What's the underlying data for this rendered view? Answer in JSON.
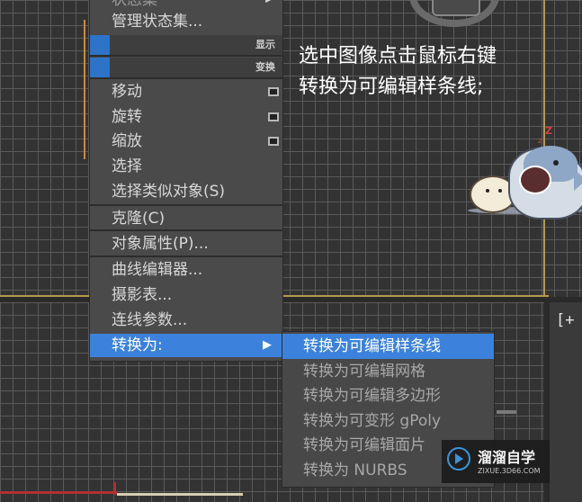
{
  "menu": {
    "partial_top_label": "状态集",
    "manage_label": "管理状态集...",
    "quad_display": "显示",
    "quad_transform": "变换",
    "items": [
      {
        "label": "移动",
        "checkbox": true
      },
      {
        "label": "旋转",
        "checkbox": true
      },
      {
        "label": "缩放",
        "checkbox": true
      },
      {
        "label": "选择",
        "checkbox": false
      },
      {
        "label": "选择类似对象(S)",
        "checkbox": false
      }
    ],
    "clone_label": "克隆(C)",
    "properties_label": "对象属性(P)...",
    "curve_editor_label": "曲线编辑器...",
    "dope_sheet_label": "摄影表...",
    "wire_params_label": "连线参数...",
    "convert_label": "转换为:"
  },
  "submenu": {
    "items": [
      {
        "label": "转换为可编辑样条线",
        "highlighted": true
      },
      {
        "label": "转换为可编辑网格",
        "highlighted": false
      },
      {
        "label": "转换为可编辑多边形",
        "highlighted": false
      },
      {
        "label": "转换为可变形 gPoly",
        "highlighted": false
      },
      {
        "label": "转换为可编辑面片",
        "highlighted": false
      },
      {
        "label": "转换为 NURBS",
        "highlighted": false
      }
    ]
  },
  "annotation": {
    "line1": "选中图像点击鼠标右键",
    "line2": "转换为可编辑样条线;"
  },
  "viewport": {
    "label": "[+"
  },
  "watermark": {
    "title": "溜溜自学",
    "url": "ZIXUE.3D66.COM"
  },
  "colors": {
    "highlight": "#3c82dc",
    "menu_bg": "#4a4a4a",
    "viewport_border": "#b49a4a"
  }
}
